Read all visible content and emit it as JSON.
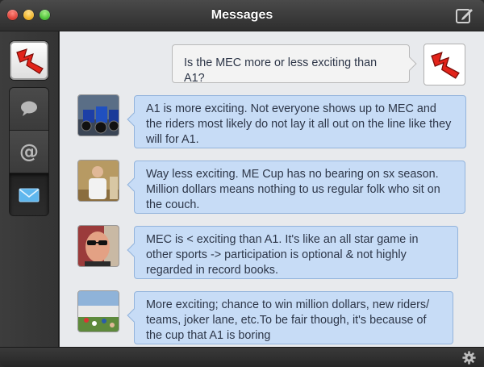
{
  "window": {
    "title": "Messages"
  },
  "sidebar": {
    "items": [
      {
        "name": "chat",
        "icon": "speech-bubble-icon"
      },
      {
        "name": "mentions",
        "icon": "at-icon"
      },
      {
        "name": "messages",
        "icon": "envelope-icon",
        "selected": true
      }
    ]
  },
  "conversation": {
    "outgoing": {
      "text": "Is the MEC more or less exciting than A1?"
    },
    "replies": [
      {
        "text": "A1 is more exciting. Not everyone shows up to MEC and the riders most likely do not lay it all out on the line like they will for A1."
      },
      {
        "text": "Way less exciting. ME Cup has no bearing on sx season. Million dollars means nothing to us regular folk who sit on the couch."
      },
      {
        "text": "MEC is < exciting than A1. It's like an all star game in other sports -> participation is optional & not highly regarded in record books."
      },
      {
        "text": "More exciting; chance to win million dollars, new riders/ teams, joker lane, etc.To be fair though, it's because of the cup that A1 is boring"
      }
    ]
  },
  "colors": {
    "incoming_bubble": "#c7dcf6",
    "outgoing_bubble": "#f3f3f3",
    "brand_red": "#e2231a"
  }
}
